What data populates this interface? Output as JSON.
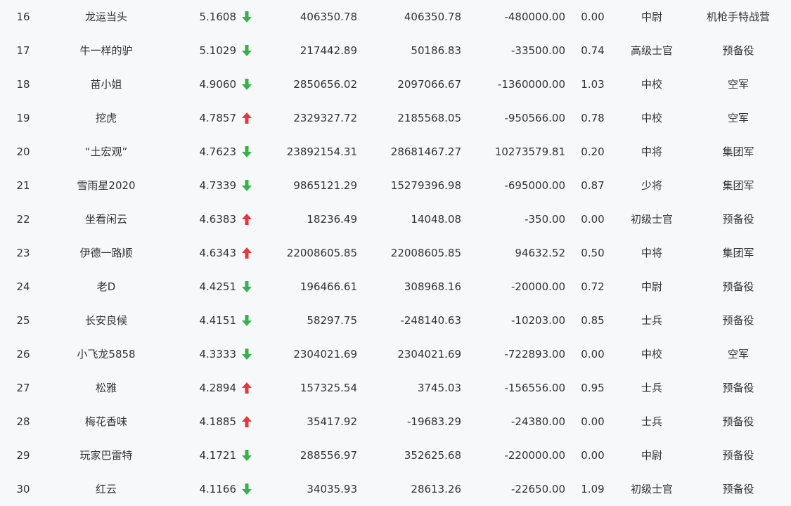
{
  "colors": {
    "up": "#e5383b",
    "down": "#35b34a",
    "text": "#333333",
    "background": "#f7f8fa"
  },
  "rows": [
    {
      "rank": "16",
      "name": "龙运当头",
      "score": "5.1608",
      "trend": "down",
      "v1": "406350.78",
      "v2": "406350.78",
      "v3": "-480000.00",
      "ratio": "0.00",
      "level": "中尉",
      "unit": "机枪手特战营"
    },
    {
      "rank": "17",
      "name": "牛一样的驴",
      "score": "5.1029",
      "trend": "down",
      "v1": "217442.89",
      "v2": "50186.83",
      "v3": "-33500.00",
      "ratio": "0.74",
      "level": "高级士官",
      "unit": "预备役"
    },
    {
      "rank": "18",
      "name": "苗小姐",
      "score": "4.9060",
      "trend": "down",
      "v1": "2850656.02",
      "v2": "2097066.67",
      "v3": "-1360000.00",
      "ratio": "1.03",
      "level": "中校",
      "unit": "空军"
    },
    {
      "rank": "19",
      "name": "挖虎",
      "score": "4.7857",
      "trend": "up",
      "v1": "2329327.72",
      "v2": "2185568.05",
      "v3": "-950566.00",
      "ratio": "0.78",
      "level": "中校",
      "unit": "空军"
    },
    {
      "rank": "20",
      "name": "“土宏观”",
      "score": "4.7623",
      "trend": "down",
      "v1": "23892154.31",
      "v2": "28681467.27",
      "v3": "10273579.81",
      "ratio": "0.20",
      "level": "中将",
      "unit": "集团军"
    },
    {
      "rank": "21",
      "name": "雪雨星2020",
      "score": "4.7339",
      "trend": "down",
      "v1": "9865121.29",
      "v2": "15279396.98",
      "v3": "-695000.00",
      "ratio": "0.87",
      "level": "少将",
      "unit": "集团军"
    },
    {
      "rank": "22",
      "name": "坐看闲云",
      "score": "4.6383",
      "trend": "up",
      "v1": "18236.49",
      "v2": "14048.08",
      "v3": "-350.00",
      "ratio": "0.00",
      "level": "初级士官",
      "unit": "预备役"
    },
    {
      "rank": "23",
      "name": "伊德一路顺",
      "score": "4.6343",
      "trend": "up",
      "v1": "22008605.85",
      "v2": "22008605.85",
      "v3": "94632.52",
      "ratio": "0.50",
      "level": "中将",
      "unit": "集团军"
    },
    {
      "rank": "24",
      "name": "老D",
      "score": "4.4251",
      "trend": "down",
      "v1": "196466.61",
      "v2": "308968.16",
      "v3": "-20000.00",
      "ratio": "0.72",
      "level": "中尉",
      "unit": "预备役"
    },
    {
      "rank": "25",
      "name": "长安良候",
      "score": "4.4151",
      "trend": "down",
      "v1": "58297.75",
      "v2": "-248140.63",
      "v3": "-10203.00",
      "ratio": "0.85",
      "level": "士兵",
      "unit": "预备役"
    },
    {
      "rank": "26",
      "name": "小飞龙5858",
      "score": "4.3333",
      "trend": "down",
      "v1": "2304021.69",
      "v2": "2304021.69",
      "v3": "-722893.00",
      "ratio": "0.00",
      "level": "中校",
      "unit": "空军"
    },
    {
      "rank": "27",
      "name": "松雅",
      "score": "4.2894",
      "trend": "up",
      "v1": "157325.54",
      "v2": "3745.03",
      "v3": "-156556.00",
      "ratio": "0.95",
      "level": "士兵",
      "unit": "预备役"
    },
    {
      "rank": "28",
      "name": "梅花香味",
      "score": "4.1885",
      "trend": "up",
      "v1": "35417.92",
      "v2": "-19683.29",
      "v3": "-24380.00",
      "ratio": "0.00",
      "level": "士兵",
      "unit": "预备役"
    },
    {
      "rank": "29",
      "name": "玩家巴雷特",
      "score": "4.1721",
      "trend": "down",
      "v1": "288556.97",
      "v2": "352625.68",
      "v3": "-220000.00",
      "ratio": "0.00",
      "level": "中尉",
      "unit": "预备役"
    },
    {
      "rank": "30",
      "name": "红云",
      "score": "4.1166",
      "trend": "down",
      "v1": "34035.93",
      "v2": "28613.26",
      "v3": "-22650.00",
      "ratio": "1.09",
      "level": "初级士官",
      "unit": "预备役"
    }
  ]
}
